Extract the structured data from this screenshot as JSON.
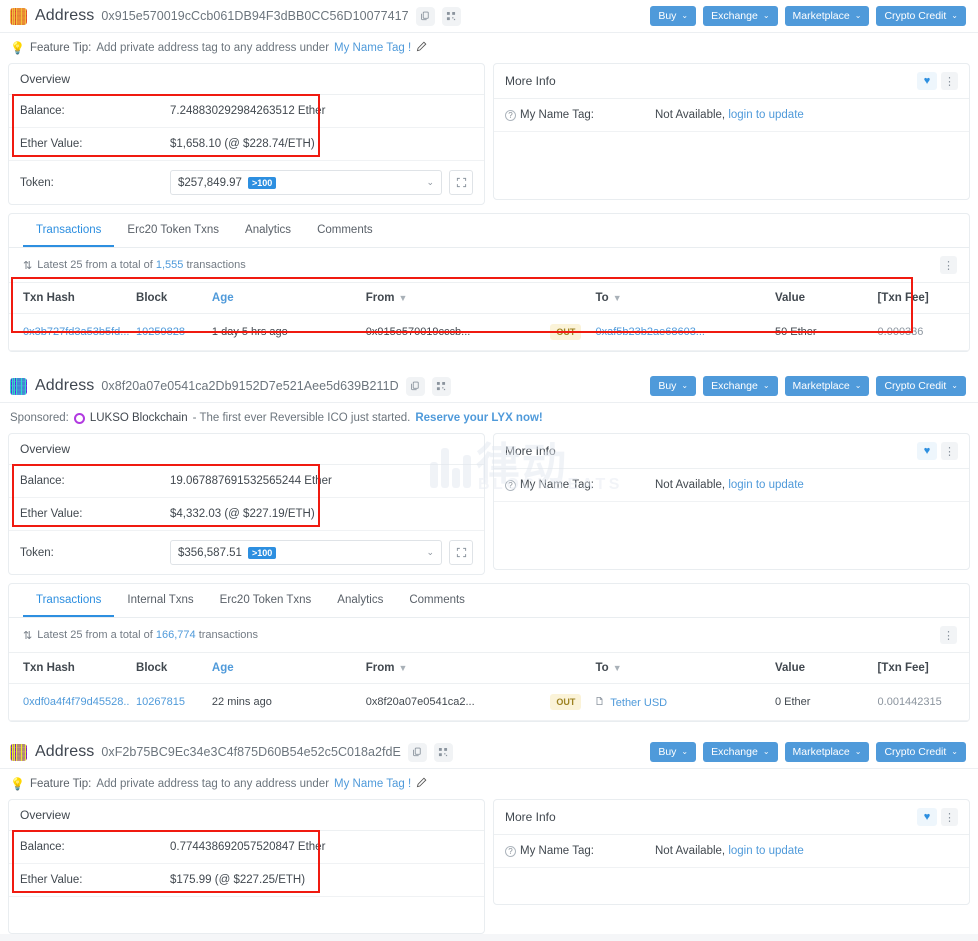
{
  "colors": {
    "accent": "#4f9ada",
    "link": "#4f9ada",
    "highlight": "#f01a10",
    "badge": "#2d8fe0"
  },
  "action_buttons": [
    {
      "label": "Buy",
      "caret": "⌄"
    },
    {
      "label": "Exchange",
      "caret": "⌄"
    },
    {
      "label": "Marketplace",
      "caret": "⌄"
    },
    {
      "label": "Crypto Credit",
      "caret": "⌄"
    }
  ],
  "icons": {
    "copy": "copy-icon",
    "qr": "qr-code-icon",
    "heart": "♥",
    "dots": "⋮",
    "bulb": "💡",
    "pen": "✒",
    "sort": "⇅",
    "filter": "▼",
    "expand": "⛶",
    "caret_down": "⌄",
    "doc": "☷"
  },
  "more_info": {
    "title": "More Info",
    "name_tag_label": "My Name Tag:",
    "name_tag_value": "Not Available,",
    "name_tag_link": "login to update"
  },
  "overview": {
    "title": "Overview",
    "balance_label": "Balance:",
    "ether_value_label": "Ether Value:",
    "token_label": "Token:",
    "token_badge": ">100"
  },
  "watermark": {
    "cn": "律动",
    "en": "BLOCKBEATS"
  },
  "sections": [
    {
      "id": "section-1",
      "address_word": "Address",
      "address": "0x915e570019cCcb061DB94F3dBB0CC56D10077417",
      "notice_type": "feature-tip",
      "notice": {
        "prefix": "Feature Tip:",
        "text": "Add private address tag to any address under",
        "link": "My Name Tag !"
      },
      "balance": "7.248830292984263512 Ether",
      "ether_value": "$1,658.10 (@ $228.74/ETH)",
      "token_value": "$257,849.97",
      "tabs": [
        {
          "label": "Transactions",
          "active": true
        },
        {
          "label": "Erc20 Token Txns",
          "active": false
        },
        {
          "label": "Analytics",
          "active": false
        },
        {
          "label": "Comments",
          "active": false
        }
      ],
      "table_meta": {
        "prefix": "Latest 25 from a total of",
        "count": "1,555",
        "suffix": "transactions"
      },
      "columns": [
        "Txn Hash",
        "Block",
        "Age",
        "From",
        "",
        "To",
        "Value",
        "[Txn Fee]"
      ],
      "rows": [
        {
          "txn_hash": "0x3b727fd3a53b5fd...",
          "block": "10259828",
          "age": "1 day 5 hrs ago",
          "from": "0x915e570019cccb...",
          "direction": "OUT",
          "to": "0xaf5b23b2ae68603...",
          "to_is_token": false,
          "value": "50 Ether",
          "fee": "0.000336"
        }
      ]
    },
    {
      "id": "section-2",
      "address_word": "Address",
      "address": "0x8f20a07e0541ca2Db9152D7e521Aee5d639B211D",
      "notice_type": "sponsored",
      "notice": {
        "prefix": "Sponsored:",
        "brand": "LUKSO Blockchain",
        "text": "- The first ever Reversible ICO just started.",
        "link": "Reserve your LYX now!"
      },
      "balance": "19.067887691532565244 Ether",
      "ether_value": "$4,332.03 (@ $227.19/ETH)",
      "token_value": "$356,587.51",
      "tabs": [
        {
          "label": "Transactions",
          "active": true
        },
        {
          "label": "Internal Txns",
          "active": false
        },
        {
          "label": "Erc20 Token Txns",
          "active": false
        },
        {
          "label": "Analytics",
          "active": false
        },
        {
          "label": "Comments",
          "active": false
        }
      ],
      "table_meta": {
        "prefix": "Latest 25 from a total of",
        "count": "166,774",
        "suffix": "transactions"
      },
      "columns": [
        "Txn Hash",
        "Block",
        "Age",
        "From",
        "",
        "To",
        "Value",
        "[Txn Fee]"
      ],
      "rows": [
        {
          "txn_hash": "0xdf0a4f4f79d45528...",
          "block": "10267815",
          "age": "22 mins ago",
          "from": "0x8f20a07e0541ca2...",
          "direction": "OUT",
          "to": "Tether USD",
          "to_is_token": true,
          "value": "0 Ether",
          "fee": "0.001442315"
        }
      ]
    },
    {
      "id": "section-3",
      "address_word": "Address",
      "address": "0xF2b75BC9Ec34e3C4f875D60B54e52c5C018a2fdE",
      "notice_type": "feature-tip",
      "notice": {
        "prefix": "Feature Tip:",
        "text": "Add private address tag to any address under",
        "link": "My Name Tag !"
      },
      "balance": "0.774438692057520847 Ether",
      "ether_value": "$175.99 (@ $227.25/ETH)",
      "token_value": "",
      "tabs": [],
      "table_meta": null,
      "columns": [],
      "rows": []
    }
  ]
}
